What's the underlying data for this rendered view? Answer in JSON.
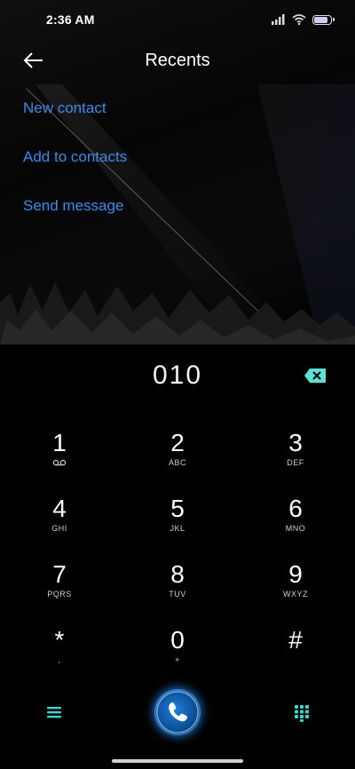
{
  "status": {
    "time": "2:36 AM",
    "icons": [
      "signal-icon",
      "wifi-icon",
      "battery-icon"
    ],
    "battery_level": 0.85
  },
  "header": {
    "title": "Recents",
    "back_icon": "arrow-left-icon"
  },
  "actions": [
    {
      "label": "New contact"
    },
    {
      "label": "Add to contacts"
    },
    {
      "label": "Send message"
    }
  ],
  "dialer": {
    "number": "010",
    "backspace_icon": "backspace-icon",
    "keys": [
      {
        "digit": "1",
        "letters": "voicemail-icon"
      },
      {
        "digit": "2",
        "letters": "ABC"
      },
      {
        "digit": "3",
        "letters": "DEF"
      },
      {
        "digit": "4",
        "letters": "GHI"
      },
      {
        "digit": "5",
        "letters": "JKL"
      },
      {
        "digit": "6",
        "letters": "MNO"
      },
      {
        "digit": "7",
        "letters": "PQRS"
      },
      {
        "digit": "8",
        "letters": "TUV"
      },
      {
        "digit": "9",
        "letters": "WXYZ"
      },
      {
        "digit": "*",
        "letters": ","
      },
      {
        "digit": "0",
        "letters": "+"
      },
      {
        "digit": "#",
        "letters": ""
      }
    ]
  },
  "bottom_bar": {
    "menu_icon": "menu-icon",
    "call_icon": "phone-call-icon",
    "dialpad_icon": "dialpad-icon"
  },
  "colors": {
    "accent_link": "#3d8bea",
    "icon_teal": "#3fd6c9",
    "call_blue": "#1e7fd8",
    "background": "#000000"
  }
}
